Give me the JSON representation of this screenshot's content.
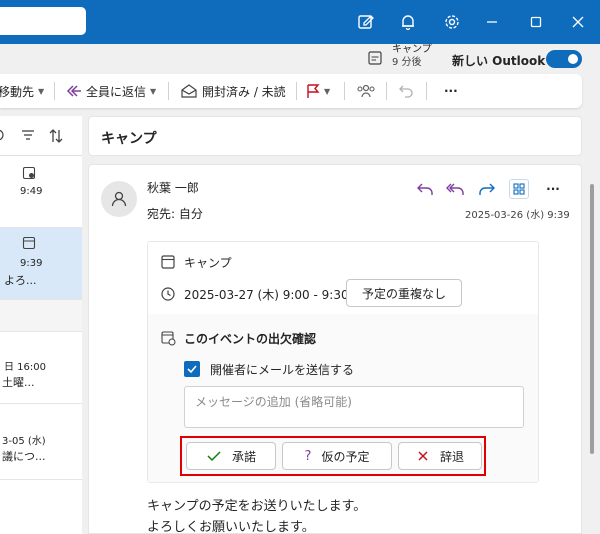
{
  "titlebar": {
    "icons": [
      "compose-note-icon",
      "bell-icon",
      "gear-icon",
      "minimize-icon",
      "maximize-icon",
      "close-icon"
    ]
  },
  "status": {
    "next_event_title": "キャンプ",
    "next_event_time": "9 分後",
    "new_outlook_label": "新しい Outlook"
  },
  "ribbon": {
    "move_label": "移動先",
    "reply_all_label": "全員に返信",
    "read_unread_label": "開封済み / 未読",
    "more_label": "···"
  },
  "list": {
    "items": [
      {
        "time": "9:49"
      },
      {
        "time": "9:39",
        "preview": "よろ..."
      },
      {
        "date": "日 16:00",
        "preview": "土曜..."
      },
      {
        "date": "3-05 (水)",
        "preview": "議につ..."
      }
    ]
  },
  "message": {
    "subject": "キャンプ",
    "sender": "秋葉 一郎",
    "to": "宛先: 自分",
    "date": "2025-03-26 (水) 9:39",
    "event_title": "キャンプ",
    "event_time": "2025-03-27 (木) 9:00 - 9:30",
    "conflict_label": "予定の重複なし",
    "rsvp_title": "このイベントの出欠確認",
    "send_email_label": "開催者にメールを送信する",
    "message_placeholder": "メッセージの追加 (省略可能)",
    "accept_label": "承諾",
    "tentative_label": "仮の予定",
    "decline_label": "辞退",
    "body_line1": "キャンプの予定をお送りいたします。",
    "body_line2": "よろしくお願いいたします。"
  },
  "colors": {
    "brand": "#0f6cbd",
    "accent_purple": "#7e3ea1",
    "decline_red": "#c50f1f",
    "accept_green": "#107c10",
    "highlight": "#e00000"
  }
}
